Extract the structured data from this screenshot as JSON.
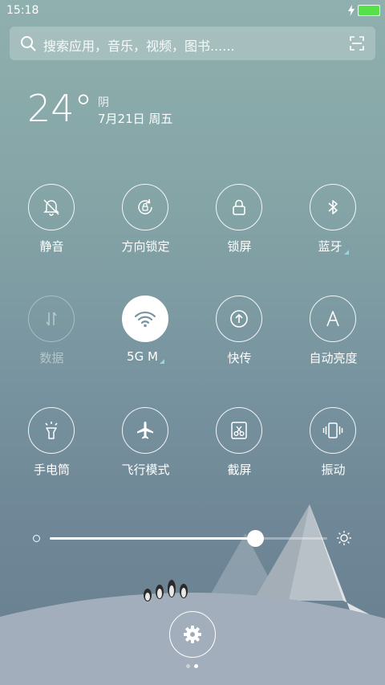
{
  "status_bar": {
    "time": "15:18",
    "battery_color": "#56e04a"
  },
  "search": {
    "placeholder": "搜索应用，音乐，视频，图书......"
  },
  "weather": {
    "temperature": "24°",
    "condition": "阴",
    "date": "7月21日 周五"
  },
  "toggles": [
    {
      "label": "静音",
      "icon": "bell-off-icon"
    },
    {
      "label": "方向锁定",
      "icon": "rotation-lock-icon"
    },
    {
      "label": "锁屏",
      "icon": "lock-icon"
    },
    {
      "label": "蓝牙",
      "icon": "bluetooth-icon"
    },
    {
      "label": "数据",
      "icon": "data-arrows-icon",
      "state": "disabled"
    },
    {
      "label": "5G M",
      "icon": "wifi-icon",
      "state": "active"
    },
    {
      "label": "快传",
      "icon": "quick-transfer-icon"
    },
    {
      "label": "自动亮度",
      "icon": "auto-brightness-icon"
    },
    {
      "label": "手电筒",
      "icon": "flashlight-icon"
    },
    {
      "label": "飞行模式",
      "icon": "airplane-icon"
    },
    {
      "label": "截屏",
      "icon": "screenshot-icon"
    },
    {
      "label": "振动",
      "icon": "vibrate-icon"
    }
  ],
  "brightness": {
    "level": 0.74
  },
  "pager": {
    "current": 2,
    "total": 2
  }
}
